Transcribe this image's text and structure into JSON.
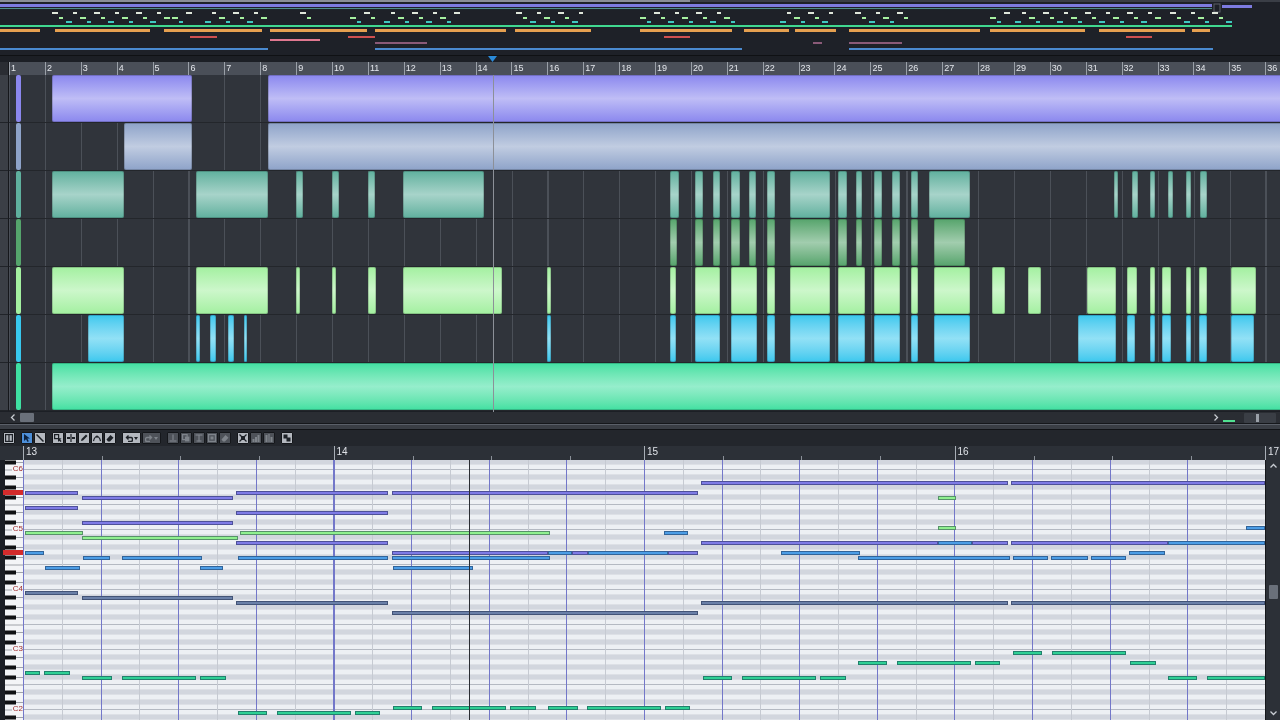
{
  "arrangement": {
    "ruler": [
      "1",
      "2",
      "3",
      "4",
      "5",
      "6",
      "7",
      "8",
      "9",
      "10",
      "11",
      "12",
      "13",
      "14",
      "15",
      "16",
      "17",
      "18",
      "19",
      "20",
      "21",
      "22",
      "23",
      "24",
      "25",
      "26",
      "27",
      "28",
      "29",
      "30",
      "31",
      "32",
      "33",
      "34",
      "35",
      "36"
    ],
    "tracks": [
      {
        "color": "#8b87ee"
      },
      {
        "color": "#8ea3c9"
      },
      {
        "color": "#5fb09e"
      },
      {
        "color": "#55a46c"
      },
      {
        "color": "#a3f0a0"
      },
      {
        "color": "#38c8ee"
      },
      {
        "color": "#3fe0a2"
      }
    ],
    "zoom_slider": {
      "level": 0.4
    }
  },
  "piano_roll": {
    "toolbar": [
      {
        "buttons": [
          {
            "kind": "panel",
            "selected": false,
            "disabled": false
          }
        ]
      },
      {
        "buttons": [
          {
            "kind": "pointer",
            "selected": true,
            "disabled": false
          },
          {
            "kind": "line",
            "selected": false,
            "disabled": false
          }
        ]
      },
      {
        "buttons": [
          {
            "kind": "box-select",
            "selected": false,
            "disabled": false
          },
          {
            "kind": "split",
            "selected": false,
            "disabled": false
          },
          {
            "kind": "draw",
            "selected": false,
            "disabled": false
          },
          {
            "kind": "bend",
            "selected": false,
            "disabled": false
          },
          {
            "kind": "erase",
            "selected": false,
            "disabled": false
          }
        ]
      },
      {
        "buttons": [
          {
            "kind": "undo",
            "selected": false,
            "disabled": false
          },
          {
            "kind": "redo",
            "selected": false,
            "disabled": true
          }
        ]
      },
      {
        "buttons": [
          {
            "kind": "stamp",
            "selected": false,
            "disabled": true
          },
          {
            "kind": "copy",
            "selected": false,
            "disabled": true
          },
          {
            "kind": "text",
            "selected": false,
            "disabled": true
          },
          {
            "kind": "square",
            "selected": false,
            "disabled": true
          },
          {
            "kind": "eraser",
            "selected": false,
            "disabled": true
          }
        ]
      },
      {
        "buttons": [
          {
            "kind": "fit",
            "selected": false,
            "disabled": false
          },
          {
            "kind": "bars",
            "selected": false,
            "disabled": true
          },
          {
            "kind": "split-bars",
            "selected": false,
            "disabled": true
          }
        ]
      },
      {
        "buttons": [
          {
            "kind": "maximize",
            "selected": false,
            "disabled": false
          }
        ]
      }
    ],
    "ruler": [
      "13",
      "14",
      "15",
      "16",
      "17"
    ],
    "keyboard": [
      "C6",
      "C5",
      "C4",
      "C3",
      "C2"
    ]
  }
}
